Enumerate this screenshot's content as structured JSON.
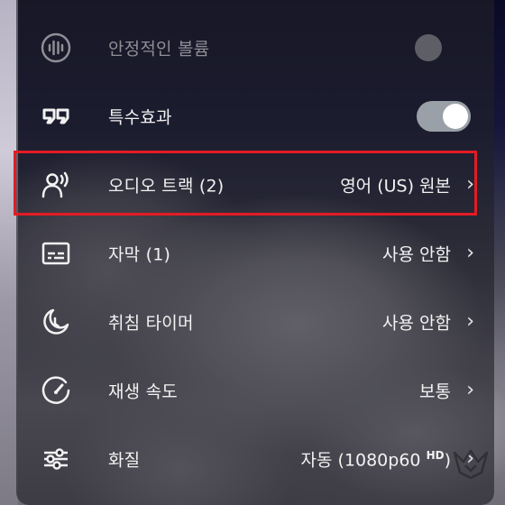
{
  "menu": {
    "items": [
      {
        "id": "stable-volume",
        "label": "안정적인 볼륨",
        "icon": "stable-volume-icon",
        "control": "toggle",
        "state": "off",
        "disabled": true
      },
      {
        "id": "special-effects",
        "label": "특수효과",
        "icon": "special-effects-icon",
        "control": "toggle",
        "state": "on"
      },
      {
        "id": "audio-track",
        "label": "오디오 트랙 (2)",
        "value": "영어 (US) 원본",
        "icon": "audio-track-icon",
        "highlighted": true
      },
      {
        "id": "subtitles",
        "label": "자막 (1)",
        "value": "사용 안함",
        "icon": "subtitles-icon"
      },
      {
        "id": "sleep-timer",
        "label": "취침 타이머",
        "value": "사용 안함",
        "icon": "sleep-timer-icon"
      },
      {
        "id": "playback-speed",
        "label": "재생 속도",
        "value": "보통",
        "icon": "playback-speed-icon"
      },
      {
        "id": "quality",
        "label": "화질",
        "value": "자동 (1080p60",
        "value_badge": "HD",
        "value_suffix": ")",
        "icon": "quality-icon"
      }
    ],
    "chevron": "›"
  },
  "colors": {
    "highlight": "#e41b23",
    "toggle_on_track": "#9aa0a8",
    "text": "#f2f2f2",
    "disabled_text": "#8e8e95"
  }
}
